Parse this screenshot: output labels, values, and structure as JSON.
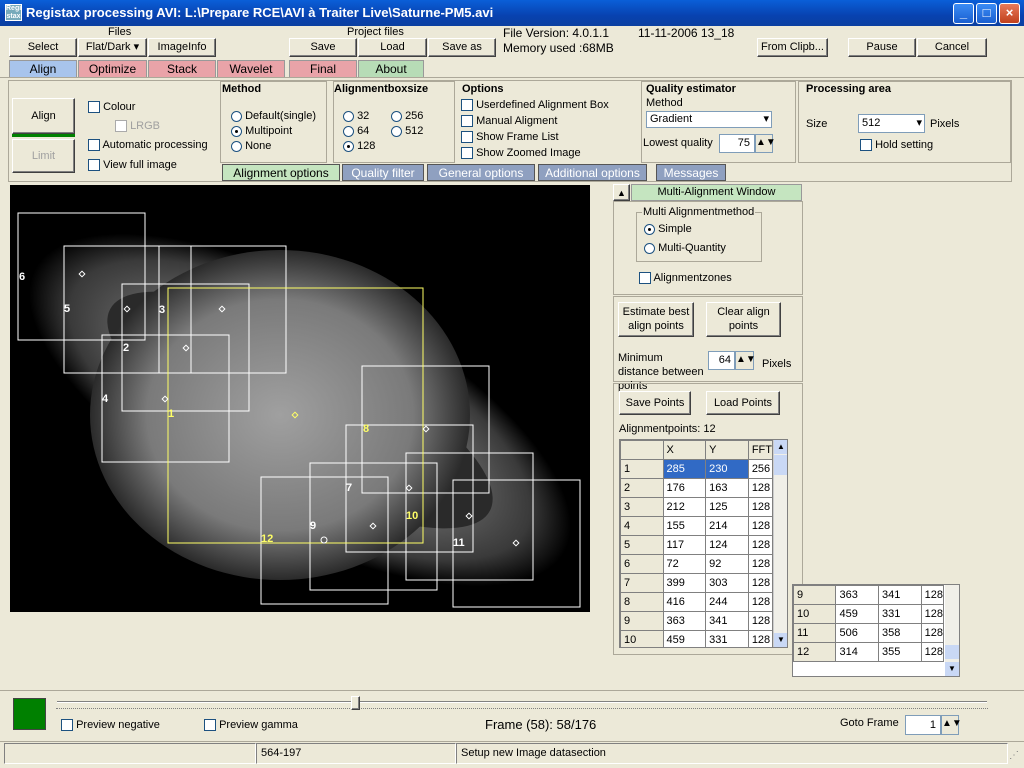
{
  "window": {
    "title": "Registax processing AVI: L:\\Prepare RCE\\AVI à Traiter Live\\Saturne-PM5.avi",
    "app_icon_text": "Regi stax"
  },
  "toolbar": {
    "files_label": "Files",
    "select": "Select",
    "flat_dark": "Flat/Dark ▾",
    "imageinfo": "ImageInfo",
    "project_files_label": "Project files",
    "save": "Save",
    "load": "Load",
    "save_as": "Save as",
    "file_version": "File Version: 4.0.1.1",
    "file_date": "11-11-2006 13_18",
    "memory_used": "Memory used :68MB",
    "from_clipboard": "From Clipb...",
    "pause": "Pause",
    "cancel": "Cancel"
  },
  "tabs": [
    "Align",
    "Optimize",
    "Stack",
    "Wavelet",
    "Final",
    "About"
  ],
  "align_panel": {
    "align_button": "Align",
    "limit_button": "Limit",
    "colour": "Colour",
    "lrgb": "LRGB",
    "automatic_processing": "Automatic processing",
    "view_full_image": "View full image"
  },
  "method": {
    "title": "Method",
    "options": [
      "Default(single)",
      "Multipoint",
      "None"
    ],
    "selected": "Multipoint"
  },
  "alignment_boxsize": {
    "title": "Alignmentboxsize",
    "options": [
      "32",
      "256",
      "64",
      "512",
      "128"
    ],
    "selected": "128"
  },
  "options": {
    "title": "Options",
    "items": [
      "Userdefined Alignment Box",
      "Manual Aligment",
      "Show Frame List",
      "Show Zoomed Image"
    ]
  },
  "quality_estimator": {
    "title": "Quality estimator",
    "method_label": "Method",
    "method_value": "Gradient",
    "lowest_quality_label": "Lowest quality",
    "lowest_quality_value": "75"
  },
  "processing_area": {
    "title": "Processing area",
    "size_label": "Size",
    "size_value": "512",
    "pixels": "Pixels",
    "hold_setting": "Hold setting"
  },
  "subtabs": [
    "Alignment options",
    "Quality filter",
    "General options",
    "Additional options",
    "Messages"
  ],
  "multi_alignment": {
    "window_title": "Multi-Alignment Window",
    "group_title": "Multi Alignmentmethod",
    "simple": "Simple",
    "multi_quantity": "Multi-Quantity",
    "alignmentzones": "Alignmentzones",
    "estimate_best": "Estimate best align points",
    "clear_align": "Clear align points",
    "min_distance_label": "Minimum distance between points",
    "min_distance_value": "64",
    "min_distance_unit": "Pixels",
    "save_points": "Save Points",
    "load_points": "Load Points",
    "alignment_count": "Alignmentpoints: 12"
  },
  "points_table": {
    "headers": [
      "",
      "X",
      "Y",
      "FFT"
    ],
    "rows": [
      [
        "1",
        "285",
        "230",
        "256"
      ],
      [
        "2",
        "176",
        "163",
        "128"
      ],
      [
        "3",
        "212",
        "125",
        "128"
      ],
      [
        "4",
        "155",
        "214",
        "128"
      ],
      [
        "5",
        "117",
        "124",
        "128"
      ],
      [
        "6",
        "72",
        "92",
        "128"
      ],
      [
        "7",
        "399",
        "303",
        "128"
      ],
      [
        "8",
        "416",
        "244",
        "128"
      ],
      [
        "9",
        "363",
        "341",
        "128"
      ],
      [
        "10",
        "459",
        "331",
        "128"
      ]
    ],
    "extra_rows": [
      [
        "9",
        "363",
        "341",
        "128"
      ],
      [
        "10",
        "459",
        "331",
        "128"
      ],
      [
        "11",
        "506",
        "358",
        "128"
      ],
      [
        "12",
        "314",
        "355",
        "128"
      ]
    ]
  },
  "image_labels": [
    "6",
    "5",
    "3",
    "2",
    "4",
    "1",
    "8",
    "7",
    "10",
    "9",
    "12",
    "11"
  ],
  "bottom": {
    "preview_negative": "Preview negative",
    "preview_gamma": "Preview gamma",
    "frame_info": "Frame (58): 58/176",
    "goto_frame_label": "Goto Frame",
    "goto_frame_value": "1",
    "slider_position": 0.32,
    "swatch_color": "#008000"
  },
  "status": {
    "coords": "564-197",
    "message": "Setup new Image datasection"
  },
  "colors": {
    "tab_active": "#a8c4ec",
    "tab_inactive": "#e9a3a8",
    "tab_about": "#b7dcb6",
    "primary_box": "#ffff66",
    "box_stroke": "#ffffff"
  }
}
